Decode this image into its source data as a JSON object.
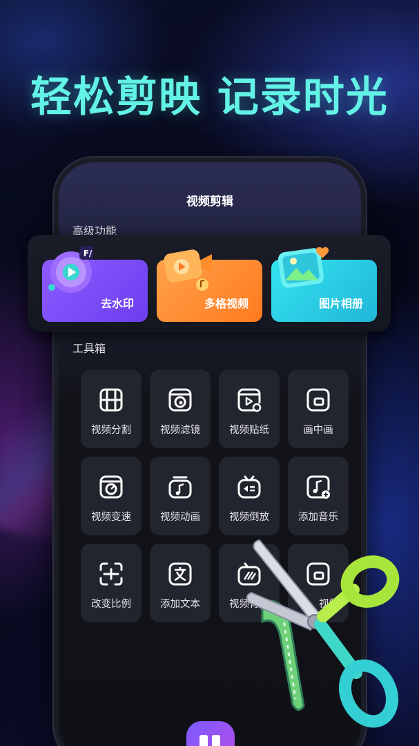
{
  "headline": "轻松剪映 记录时光",
  "screen_title": "视频剪辑",
  "sections": {
    "advanced": "高级功能",
    "toolbox": "工具箱"
  },
  "features": [
    {
      "label": "去水印",
      "icon": "remove-watermark-icon",
      "color": "#7b4cf6"
    },
    {
      "label": "多格视频",
      "icon": "multi-grid-video-icon",
      "color": "#ff8a2e"
    },
    {
      "label": "图片相册",
      "icon": "photo-album-icon",
      "color": "#2ccbe4"
    }
  ],
  "tools": [
    {
      "label": "视频分割",
      "icon": "film-split-icon"
    },
    {
      "label": "视频滤镜",
      "icon": "filter-icon"
    },
    {
      "label": "视频贴纸",
      "icon": "sticker-icon"
    },
    {
      "label": "画中画",
      "icon": "picture-in-picture-icon"
    },
    {
      "label": "视频变速",
      "icon": "speed-icon"
    },
    {
      "label": "视频动画",
      "icon": "animation-icon"
    },
    {
      "label": "视频倒放",
      "icon": "reverse-icon"
    },
    {
      "label": "添加音乐",
      "icon": "add-music-icon"
    },
    {
      "label": "改变比例",
      "icon": "aspect-ratio-icon"
    },
    {
      "label": "添加文本",
      "icon": "add-text-icon"
    },
    {
      "label": "视频背景",
      "icon": "background-icon"
    },
    {
      "label": "视频",
      "icon": "video-icon"
    }
  ],
  "colors": {
    "headline": "#63f2e6",
    "accent_purple": "#7b4cf6",
    "accent_orange": "#ff8a2e",
    "accent_cyan": "#2ccbe4"
  }
}
